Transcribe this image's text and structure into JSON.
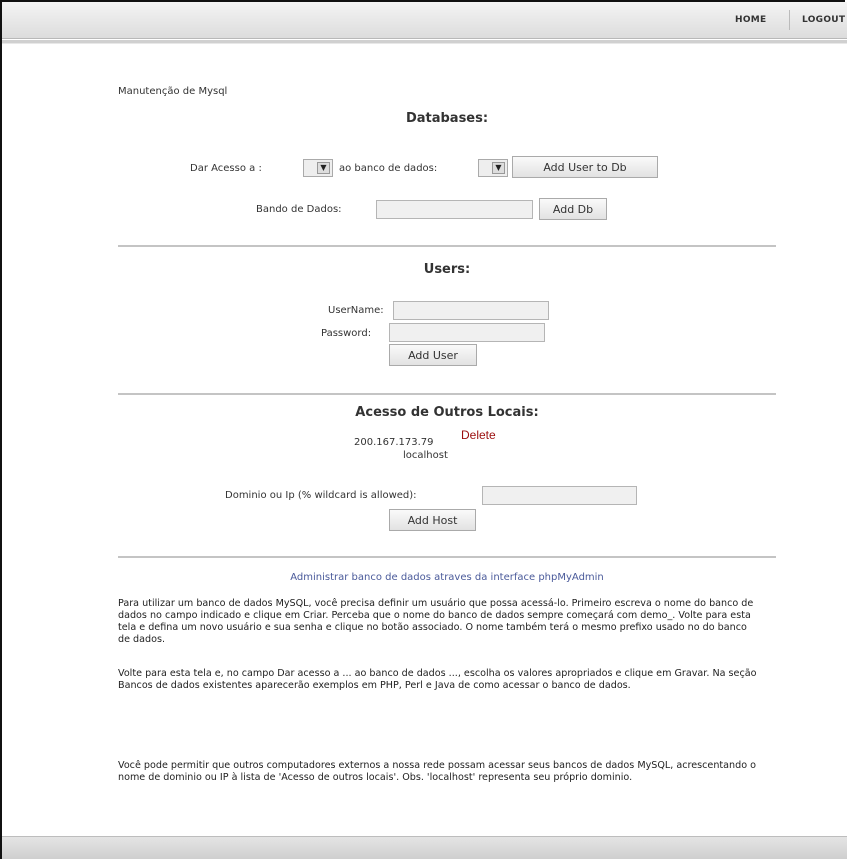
{
  "nav": {
    "home": "HOME",
    "logout": "LOGOUT"
  },
  "page_heading": "Manutenção de Mysql",
  "databases": {
    "title": "Databases:",
    "grant_label_prefix": "Dar Acesso a :",
    "grant_label_middle": "ao banco de dados:",
    "add_user_to_db_button": "Add User to Db",
    "db_name_label": "Bando de Dados:",
    "db_name_value": "",
    "add_db_button": "Add Db"
  },
  "users": {
    "title": "Users:",
    "username_label": "UserName:",
    "username_value": "",
    "password_label": "Password:",
    "password_value": "",
    "add_user_button": "Add User"
  },
  "hosts": {
    "title": "Acesso de Outros Locais:",
    "entries": [
      {
        "host": "200.167.173.79",
        "delete_label": "Delete"
      },
      {
        "host": "localhost"
      }
    ],
    "host_label": "Dominio ou Ip (% wildcard is allowed):",
    "host_value": "",
    "add_host_button": "Add Host"
  },
  "admin_link": "Administrar banco de dados atraves da interface phpMyAdmin",
  "help": {
    "p1": "Para utilizar um banco de dados MySQL, você precisa definir um usuário que possa acessá-lo. Primeiro escreva o nome do banco de dados no campo indicado e clique em Criar. Perceba que o nome do banco de dados sempre começará com demo_. Volte para esta tela e defina um novo usuário e sua senha e clique no botão associado. O nome também terá o mesmo prefixo usado no do banco de dados.",
    "p2": "Volte para esta tela e, no campo Dar acesso a ... ao banco de dados ..., escolha os valores apropriados e clique em Gravar. Na seção Bancos de dados existentes aparecerão exemplos em PHP, Perl e Java de como acessar o banco de dados.",
    "p3": "Você pode permitir que outros computadores externos a nossa rede possam acessar seus bancos de dados MySQL, acrescentando o nome de dominio ou IP à lista de 'Acesso de outros locais'. Obs. 'localhost' representa seu próprio dominio."
  },
  "colors": {
    "delete_link": "#9b0d0d",
    "admin_link": "#4a5a9a"
  }
}
